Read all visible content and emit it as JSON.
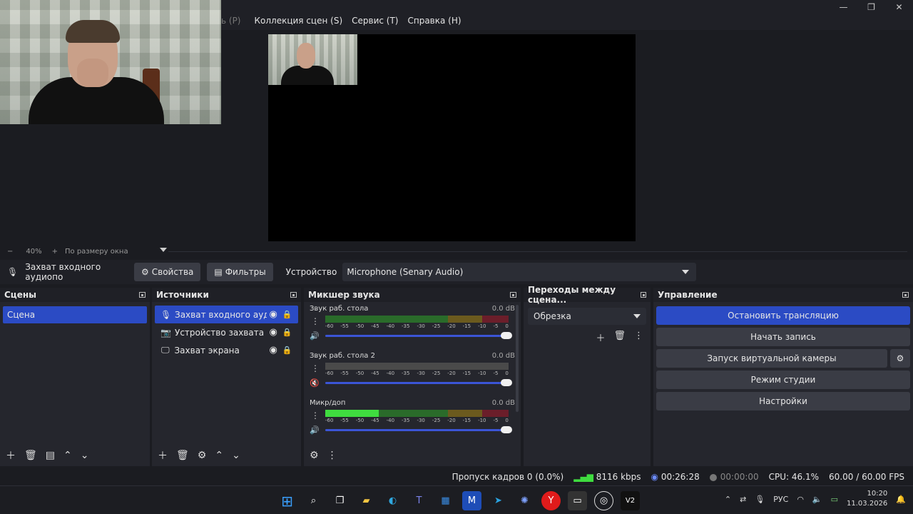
{
  "menu": {
    "faded_item": "ь (P)",
    "items": [
      "Коллекция сцен (S)",
      "Сервис (T)",
      "Справка (H)"
    ]
  },
  "window_controls": {
    "minimize": "—",
    "restore": "❐",
    "close": "✕"
  },
  "zoom": {
    "minus": "−",
    "percent": "40%",
    "plus": "+",
    "fit": "По размеру окна"
  },
  "source_toolbar": {
    "source_name": "Захват входного аудиопо",
    "properties": "Свойства",
    "filters": "Фильтры",
    "device_label": "Устройство",
    "device_value": "Microphone (Senary Audio)"
  },
  "scenes": {
    "title": "Сцены",
    "items": [
      "Сцена"
    ]
  },
  "sources": {
    "title": "Источники",
    "items": [
      {
        "name": "Захват входного аудиопо",
        "icon": "mic-icon"
      },
      {
        "name": "Устройство захвата виде",
        "icon": "camera-icon"
      },
      {
        "name": "Захват экрана",
        "icon": "monitor-icon"
      }
    ]
  },
  "mixer": {
    "title": "Микшер звука",
    "ticks": [
      "-60",
      "-55",
      "-50",
      "-45",
      "-40",
      "-35",
      "-30",
      "-25",
      "-20",
      "-15",
      "-10",
      "-5",
      "0"
    ],
    "channels": [
      {
        "name": "Звук раб. стола",
        "db": "0.0 dB",
        "muted": false,
        "level": 0
      },
      {
        "name": "Звук раб. стола 2",
        "db": "0.0 dB",
        "muted": true,
        "level": 0
      },
      {
        "name": "Микр/доп",
        "db": "0.0 dB",
        "muted": false,
        "level": 0.29
      }
    ]
  },
  "transitions": {
    "title": "Переходы между сцена...",
    "selected": "Обрезка"
  },
  "controls": {
    "title": "Управление",
    "stop_stream": "Остановить трансляцию",
    "start_record": "Начать запись",
    "virtual_cam": "Запуск виртуальной камеры",
    "studio_mode": "Режим студии",
    "settings": "Настройки"
  },
  "status": {
    "dropped": "Пропуск кадров 0 (0.0%)",
    "bitrate": "8116 kbps",
    "stream_time": "00:26:28",
    "record_time": "00:00:00",
    "cpu": "CPU: 46.1%",
    "fps": "60.00 / 60.00 FPS"
  },
  "tray": {
    "lang": "РУС",
    "time": "10:20",
    "date": "11.03.2026"
  },
  "colors": {
    "accent": "#2b4bc4",
    "meter_green": "#3fdc3f",
    "muted": "#c02030"
  }
}
